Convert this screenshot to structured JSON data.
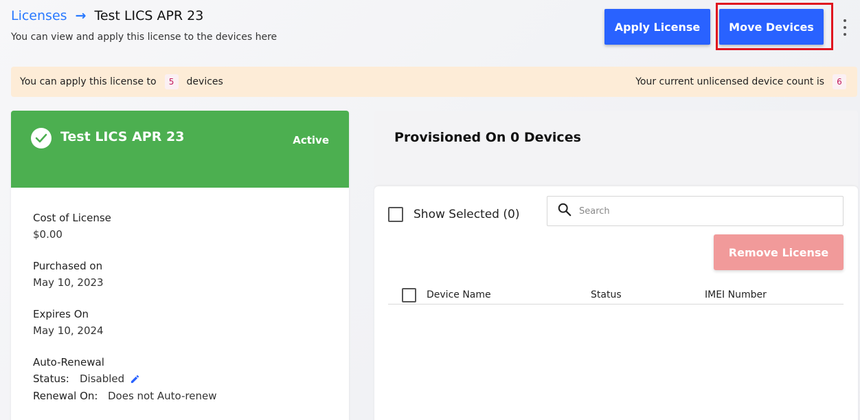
{
  "header": {
    "breadcrumb_link": "Licenses",
    "breadcrumb_current": "Test LICS APR 23",
    "subtitle": "You can view and apply this license to the devices here",
    "apply_label": "Apply License",
    "move_label": "Move Devices"
  },
  "banner": {
    "left_prefix": "You can apply this license to",
    "left_count": "5",
    "left_suffix": "devices",
    "right_text": "Your current unlicensed device count is",
    "right_count": "6"
  },
  "license": {
    "name": "Test LICS APR 23",
    "status": "Active",
    "cost_label": "Cost of License",
    "cost_value": "$0.00",
    "purchased_label": "Purchased on",
    "purchased_value": "May 10, 2023",
    "expires_label": "Expires On",
    "expires_value": "May 10, 2024",
    "renewal_label": "Auto-Renewal",
    "renewal_status_key": "Status:",
    "renewal_status_value": "Disabled",
    "renewal_on_key": "Renewal On:",
    "renewal_on_value": "Does not Auto-renew"
  },
  "devices": {
    "title": "Provisioned On 0 Devices",
    "show_selected": "Show Selected (0)",
    "search_placeholder": "Search",
    "remove_label": "Remove License",
    "columns": [
      "Device Name",
      "Status",
      "IMEI Number"
    ]
  },
  "colors": {
    "primary": "#2962ff",
    "active_green": "#4caf50",
    "remove_disabled": "#f19a9a",
    "banner_bg": "#fdecd7",
    "highlight": "#e0141e"
  }
}
